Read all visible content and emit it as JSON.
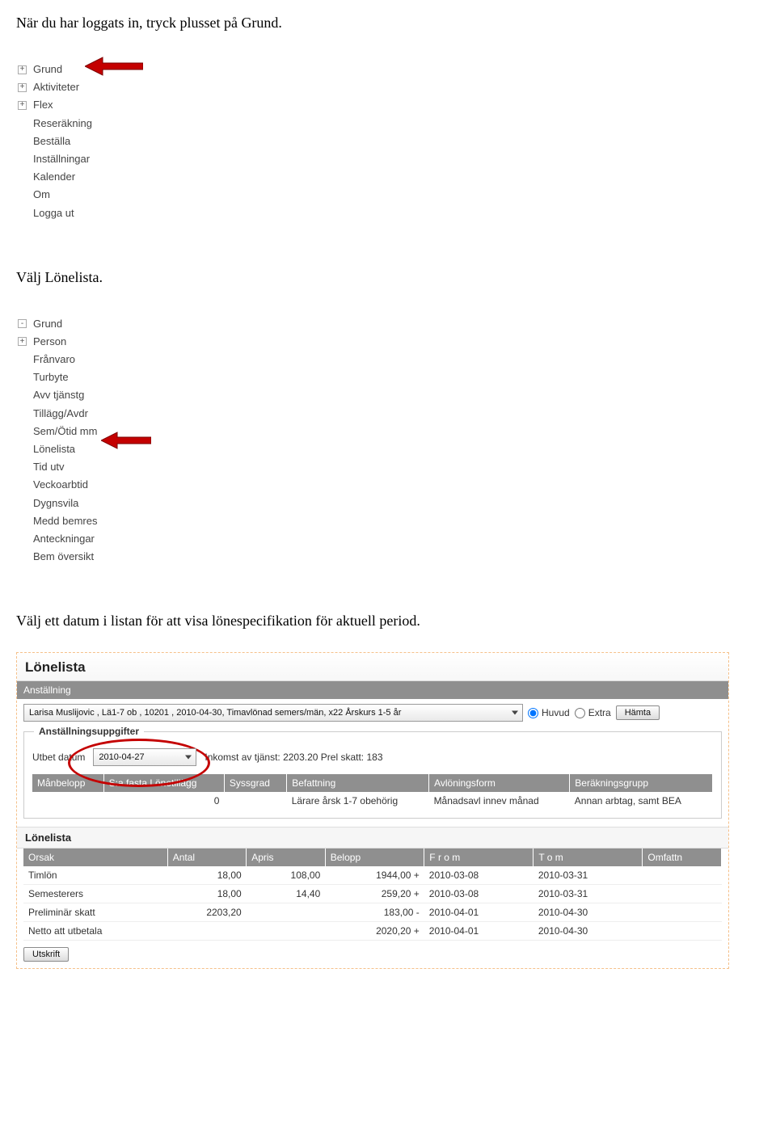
{
  "instructions": {
    "step1": "När du har loggats in, tryck plusset på Grund.",
    "step2": "Välj Lönelista.",
    "step3": "Välj ett datum i listan för att visa lönespecifikation för aktuell period."
  },
  "nav1": {
    "items": [
      {
        "label": "Grund",
        "expand": "+"
      },
      {
        "label": "Aktiviteter",
        "expand": "+"
      },
      {
        "label": "Flex",
        "expand": "+"
      },
      {
        "label": "Reseräkning",
        "expand": ""
      },
      {
        "label": "Beställa",
        "expand": ""
      },
      {
        "label": "Inställningar",
        "expand": ""
      },
      {
        "label": "Kalender",
        "expand": ""
      },
      {
        "label": "Om",
        "expand": ""
      },
      {
        "label": "Logga ut",
        "expand": ""
      }
    ]
  },
  "nav2": {
    "items": [
      {
        "label": "Grund",
        "expand": "-"
      },
      {
        "label": "Person",
        "expand": "+"
      },
      {
        "label": "Frånvaro",
        "expand": ""
      },
      {
        "label": "Turbyte",
        "expand": ""
      },
      {
        "label": "Avv tjänstg",
        "expand": ""
      },
      {
        "label": "Tillägg/Avdr",
        "expand": ""
      },
      {
        "label": "Sem/Ötid mm",
        "expand": ""
      },
      {
        "label": "Lönelista",
        "expand": ""
      },
      {
        "label": "Tid utv",
        "expand": ""
      },
      {
        "label": "Veckoarbtid",
        "expand": ""
      },
      {
        "label": "Dygnsvila",
        "expand": ""
      },
      {
        "label": "Medd bemres",
        "expand": ""
      },
      {
        "label": "Anteckningar",
        "expand": ""
      },
      {
        "label": "Bem översikt",
        "expand": ""
      }
    ]
  },
  "panel": {
    "title": "Lönelista",
    "anstallning_label": "Anställning",
    "anstallning_value": "Larisa Muslijovic , Lä1-7 ob , 10201 , 2010-04-30, Timavlönad semers/män, x22 Årskurs 1-5 år",
    "radio_huvud": "Huvud",
    "radio_extra": "Extra",
    "hamta_btn": "Hämta",
    "uppgifter_title": "Anställningsuppgifter",
    "utbet_label": "Utbet datum",
    "utbet_value": "2010-04-27",
    "inkomst_text": "Inkomst av tjänst: 2203.20 Prel skatt: 183",
    "cols": {
      "manbelopp": "Månbelopp",
      "ssa": "S:a fasta Lönetillägg",
      "syssgrad": "Syssgrad",
      "befattning": "Befattning",
      "avloningsform": "Avlöningsform",
      "berakningsgrupp": "Beräkningsgrupp"
    },
    "vals": {
      "manbelopp": "",
      "ssa": "0",
      "syssgrad": "",
      "befattning": "Lärare årsk 1-7 obehörig",
      "avloningsform": "Månadsavl innev månad",
      "berakningsgrupp": "Annan arbtag, samt BEA"
    },
    "list_title": "Lönelista",
    "list_cols": {
      "orsak": "Orsak",
      "antal": "Antal",
      "apris": "Apris",
      "belopp": "Belopp",
      "from": "F r o m",
      "tom": "T o m",
      "omfattn": "Omfattn"
    },
    "rows": [
      {
        "orsak": "Timlön",
        "antal": "18,00",
        "apris": "108,00",
        "belopp": "1944,00 +",
        "from": "2010-03-08",
        "tom": "2010-03-31",
        "omf": ""
      },
      {
        "orsak": "Semesterers",
        "antal": "18,00",
        "apris": "14,40",
        "belopp": "259,20 +",
        "from": "2010-03-08",
        "tom": "2010-03-31",
        "omf": ""
      },
      {
        "orsak": "Preliminär skatt",
        "antal": "2203,20",
        "apris": "",
        "belopp": "183,00 -",
        "from": "2010-04-01",
        "tom": "2010-04-30",
        "omf": ""
      },
      {
        "orsak": "Netto att utbetala",
        "antal": "",
        "apris": "",
        "belopp": "2020,20 +",
        "from": "2010-04-01",
        "tom": "2010-04-30",
        "omf": ""
      }
    ],
    "utskrift_btn": "Utskrift"
  }
}
